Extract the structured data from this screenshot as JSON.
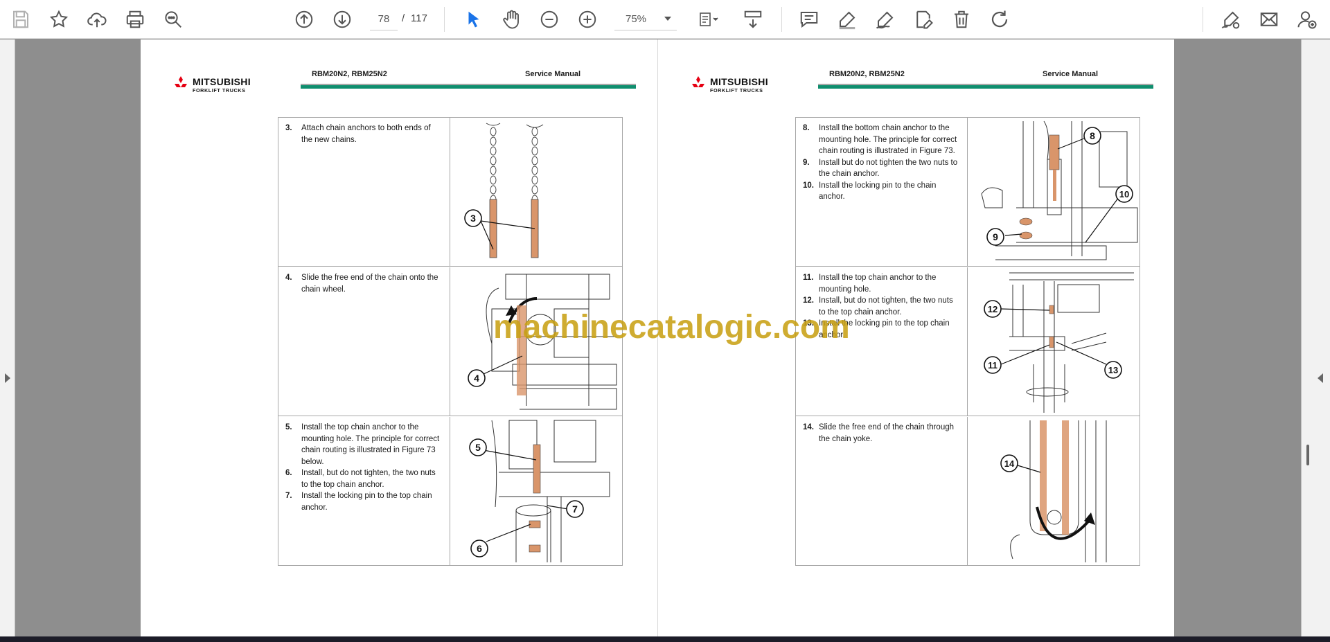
{
  "toolbar": {
    "page_current": "78",
    "page_separator": "/",
    "page_total": "117",
    "zoom_value": "75%",
    "icons": [
      "save-icon",
      "bookmark-star-icon",
      "upload-cloud-icon",
      "print-icon",
      "zoom-search-icon",
      "page-up-icon",
      "page-down-icon",
      "select-cursor-icon",
      "hand-pan-icon",
      "zoom-out-icon",
      "zoom-in-icon",
      "page-fit-icon",
      "scroll-mode-icon",
      "comment-icon",
      "highlight-pen-icon",
      "draw-icon",
      "edit-pdf-icon",
      "delete-icon",
      "rotate-icon",
      "sign-icon",
      "email-icon",
      "add-user-icon"
    ],
    "accent_color": "#1a73e8"
  },
  "pages": [
    {
      "logo": {
        "line1": "MITSUBISHI",
        "line2": "FORKLIFT TRUCKS"
      },
      "model": "RBM20N2, RBM25N2",
      "title": "Service Manual",
      "rows": [
        {
          "steps": [
            {
              "num": "3.",
              "text": "Attach chain anchors to both ends of the new chains."
            }
          ],
          "callouts": [
            "3"
          ]
        },
        {
          "steps": [
            {
              "num": "4.",
              "text": "Slide the free end of the chain onto the chain wheel."
            }
          ],
          "callouts": [
            "4"
          ]
        },
        {
          "steps": [
            {
              "num": "5.",
              "text": "Install the top chain anchor to the mounting hole. The principle for correct chain routing is illustrated in Figure 73 below."
            },
            {
              "num": "6.",
              "text": "Install, but do not tighten, the two nuts to the top chain anchor."
            },
            {
              "num": "7.",
              "text": "Install the locking pin to the top chain anchor."
            }
          ],
          "callouts": [
            "5",
            "7",
            "6"
          ]
        }
      ]
    },
    {
      "logo": {
        "line1": "MITSUBISHI",
        "line2": "FORKLIFT TRUCKS"
      },
      "model": "RBM20N2, RBM25N2",
      "title": "Service Manual",
      "rows": [
        {
          "steps": [
            {
              "num": "8.",
              "text": "Install the bottom chain anchor to the mounting hole. The principle for correct chain routing is illustrated in Figure 73."
            },
            {
              "num": "9.",
              "text": "Install but do not tighten the two nuts to the chain anchor."
            },
            {
              "num": "10.",
              "text": "Install the locking pin to the chain anchor."
            }
          ],
          "callouts": [
            "8",
            "10",
            "9"
          ]
        },
        {
          "steps": [
            {
              "num": "11.",
              "text": "Install the top chain anchor to the mounting hole."
            },
            {
              "num": "12.",
              "text": "Install, but do not tighten, the two nuts to the top chain anchor."
            },
            {
              "num": "13.",
              "text": "Install the locking pin to the top chain anchor."
            }
          ],
          "callouts": [
            "12",
            "11",
            "13"
          ]
        },
        {
          "steps": [
            {
              "num": "14.",
              "text": "Slide the free end of the chain through the chain yoke."
            }
          ],
          "callouts": [
            "14"
          ]
        }
      ]
    }
  ],
  "watermark": "machinecatalogic.com",
  "colors": {
    "rule": "#0f8e6e",
    "logo_red": "#e60012",
    "component": "#d9956a",
    "watermark": "#c8a014"
  }
}
